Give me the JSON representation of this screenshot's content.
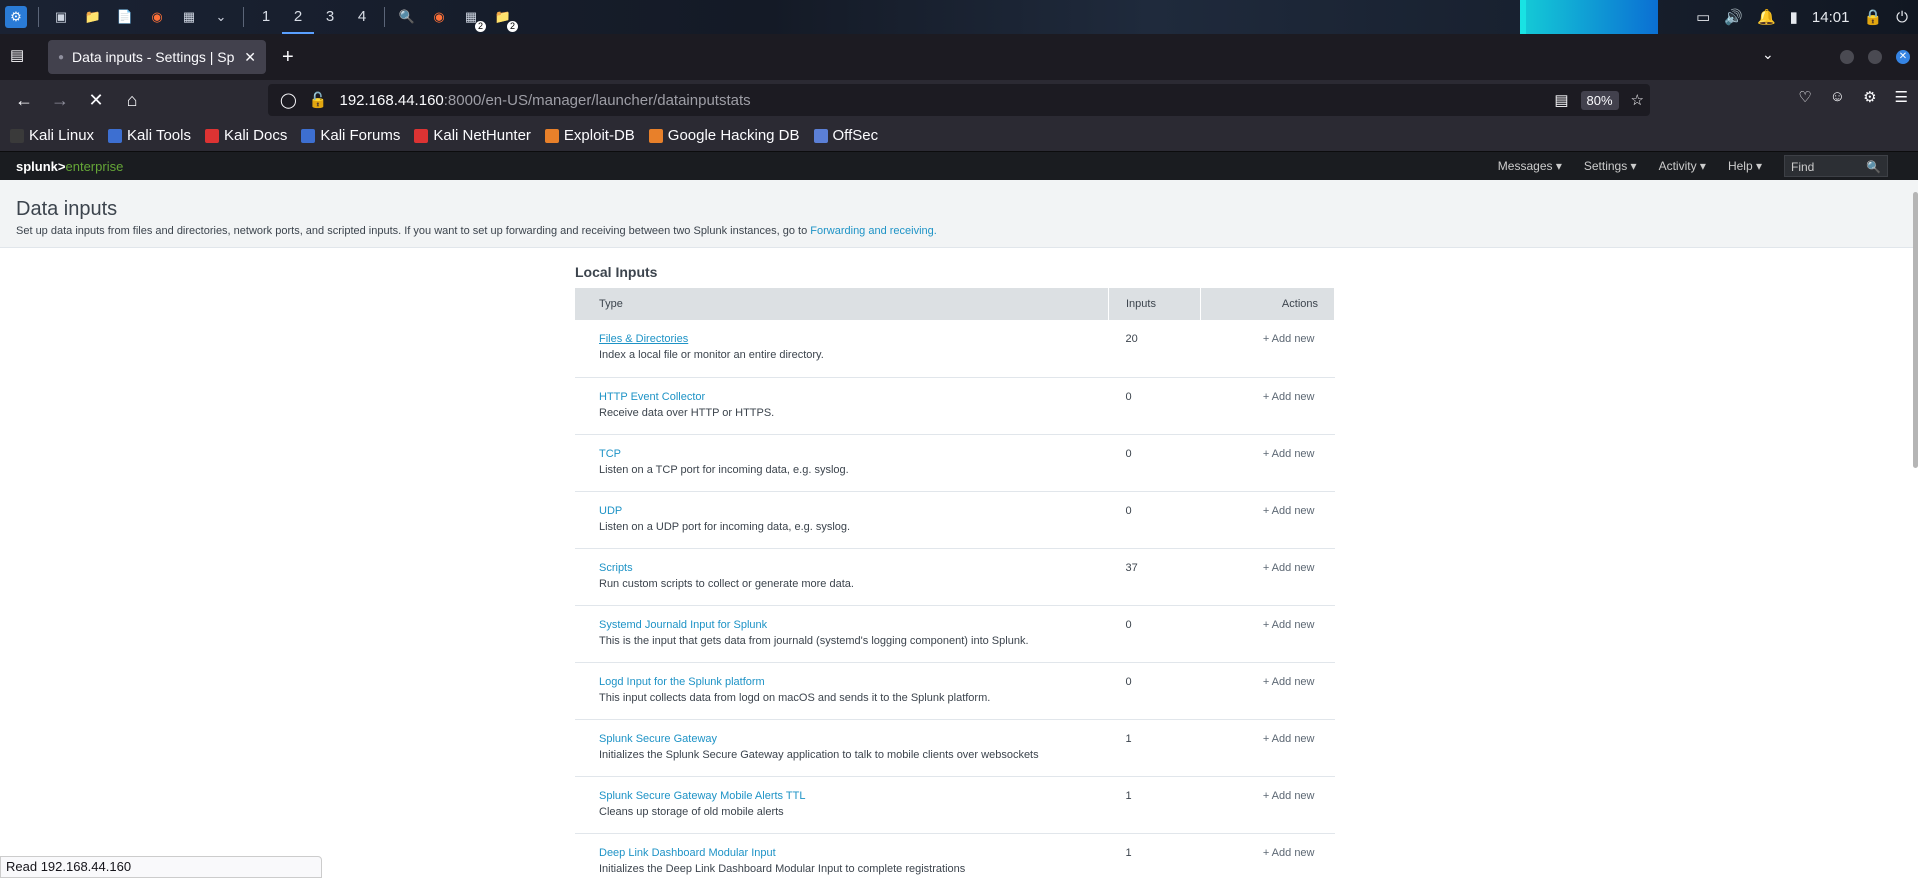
{
  "taskbar": {
    "workspaces": [
      "1",
      "2",
      "3",
      "4"
    ],
    "active_workspace": "2",
    "terminal_badge_1": "2",
    "terminal_badge_2": "2",
    "clock": "14:01"
  },
  "browser": {
    "tab_title": "Data inputs - Settings | Sp",
    "url_host": "192.168.44.160",
    "url_rest": ":8000/en-US/manager/launcher/datainputstats",
    "zoom": "80%",
    "bookmarks": [
      "Kali Linux",
      "Kali Tools",
      "Kali Docs",
      "Kali Forums",
      "Kali NetHunter",
      "Exploit-DB",
      "Google Hacking DB",
      "OffSec"
    ],
    "status_text": "Read 192.168.44.160"
  },
  "splunk": {
    "logo_main": "splunk>",
    "logo_sub": "enterprise",
    "menu": [
      "Messages ▾",
      "Settings ▾",
      "Activity ▾",
      "Help ▾"
    ],
    "find_placeholder": "Find"
  },
  "page": {
    "title": "Data inputs",
    "description": "Set up data inputs from files and directories, network ports, and scripted inputs. If you want to set up forwarding and receiving between two Splunk instances, go to ",
    "description_link": "Forwarding and receiving.",
    "section_title": "Local Inputs",
    "columns": {
      "type": "Type",
      "inputs": "Inputs",
      "actions": "Actions"
    },
    "rows": [
      {
        "name": "Files & Directories",
        "desc": "Index a local file or monitor an entire directory.",
        "count": "20",
        "action": "+ Add new"
      },
      {
        "name": "HTTP Event Collector",
        "desc": "Receive data over HTTP or HTTPS.",
        "count": "0",
        "action": "+ Add new"
      },
      {
        "name": "TCP",
        "desc": "Listen on a TCP port for incoming data, e.g. syslog.",
        "count": "0",
        "action": "+ Add new"
      },
      {
        "name": "UDP",
        "desc": "Listen on a UDP port for incoming data, e.g. syslog.",
        "count": "0",
        "action": "+ Add new"
      },
      {
        "name": "Scripts",
        "desc": "Run custom scripts to collect or generate more data.",
        "count": "37",
        "action": "+ Add new"
      },
      {
        "name": "Systemd Journald Input for Splunk",
        "desc": "This is the input that gets data from journald (systemd's logging component) into Splunk.",
        "count": "0",
        "action": "+ Add new"
      },
      {
        "name": "Logd Input for the Splunk platform",
        "desc": "This input collects data from logd on macOS and sends it to the Splunk platform.",
        "count": "0",
        "action": "+ Add new"
      },
      {
        "name": "Splunk Secure Gateway",
        "desc": "Initializes the Splunk Secure Gateway application to talk to mobile clients over websockets",
        "count": "1",
        "action": "+ Add new"
      },
      {
        "name": "Splunk Secure Gateway Mobile Alerts TTL",
        "desc": "Cleans up storage of old mobile alerts",
        "count": "1",
        "action": "+ Add new"
      },
      {
        "name": "Deep Link Dashboard Modular Input",
        "desc": "Initializes the Deep Link Dashboard Modular Input to complete registrations",
        "count": "1",
        "action": "+ Add new"
      }
    ]
  },
  "colors": {
    "link": "#1e93c6",
    "splunk_green": "#65a637",
    "header_bg": "#f2f4f5",
    "table_header_bg": "#dce0e3"
  }
}
